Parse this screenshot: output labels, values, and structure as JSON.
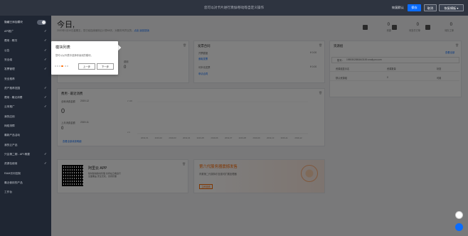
{
  "topbar": {
    "hint": "您可以对卡片进行添加/移动等自定义操作",
    "exit_label": "恢复默认",
    "save_label": "保存",
    "cancel_label": "取消",
    "recover_label": "恢复模板"
  },
  "sidebar": {
    "toggle_label": "隐藏已添加模块",
    "items": [
      {
        "label": "API推广",
        "checked": true
      },
      {
        "label": "费用 - 概况",
        "checked": true
      },
      {
        "label": "公告",
        "checked": true
      },
      {
        "label": "安全组",
        "checked": true
      },
      {
        "label": "发票管理",
        "checked": true
      },
      {
        "label": "安全推荐",
        "checked": false
      },
      {
        "label": "资产推荐范围",
        "checked": true
      },
      {
        "label": "费用 - 最近消费",
        "checked": true
      },
      {
        "label": "云采推广",
        "checked": true
      },
      {
        "label": "我的应用",
        "checked": false
      },
      {
        "label": "网络排障",
        "checked": false
      },
      {
        "label": "最新产品活动",
        "checked": false
      },
      {
        "label": "我的云产品",
        "checked": false
      },
      {
        "label": "只会第二期 - API 概要",
        "checked": true
      },
      {
        "label": "资源包使用",
        "checked": true
      },
      {
        "label": "RAM访问控制",
        "checked": false
      },
      {
        "label": "最近使用的产品",
        "checked": false
      },
      {
        "label": "工作台",
        "checked": false
      }
    ]
  },
  "greeting": {
    "title": "今日,",
    "subtitle": "2020年1月10日星期五，您已经连续使用云计算68天，对服务有异议的，",
    "link1": "点此",
    "link2": "返回旧版"
  },
  "stats": [
    {
      "value": "0",
      "caption": "资源"
    },
    {
      "value": "0",
      "caption": "待支付订单"
    },
    {
      "value": "0",
      "caption": "待办工单"
    }
  ],
  "card_left_top": {
    "title": "",
    "stat_label": "费用",
    "stat_value": "0"
  },
  "card_invoice": {
    "title": "发票合同",
    "rows": [
      {
        "label": "开票额度",
        "value": "¥ 0.00"
      },
      {
        "label": "索取发票",
        "value": ""
      },
      {
        "label": "可申请发票",
        "value": "¥ 0.00"
      },
      {
        "label": "申请合同",
        "value": ""
      }
    ]
  },
  "card_resources": {
    "title": "资源组",
    "account_label": "账号：",
    "account_value": "1989302850843159.onaliyun.com",
    "manage_link": "查看全部",
    "headers": [
      "资源组显示名",
      "资源数量",
      "",
      "状态"
    ],
    "row": [
      "默认资源组",
      "0",
      "",
      "可用"
    ]
  },
  "card_spend": {
    "title": "费用 - 最近消费",
    "month_label": "全局消费金额",
    "month_date": "2019-12",
    "amount": "0",
    "next_label": "上月消费金额",
    "next_date": "2019-11",
    "amount2": "0",
    "link": "查看全部消费明细"
  },
  "chart_data": {
    "type": "bar",
    "categories": [
      "2019-01",
      "2019-02",
      "2019-03",
      "2019-04",
      "2019-05",
      "2019-06",
      "2019-07",
      "2019-08",
      "2019-09",
      "2019-10",
      "2019-11",
      "2019-12"
    ],
    "values": [
      0,
      0,
      0,
      0,
      0,
      0,
      0,
      0,
      0,
      0,
      0,
      0
    ],
    "ylabels": [
      "¥ 100",
      "¥ 0"
    ],
    "xlabel": "",
    "ylabel": ""
  },
  "card_app": {
    "title": "阿里云 APP",
    "desc1": "随时随地移动管理 支持在云端运行",
    "desc2": "全面覆盖 安全无忧，支持管理"
  },
  "card_promo": {
    "title": "第六代服务器震撼发售",
    "subtitle": "内置第二代英特尔至强可扩展处理器",
    "cta": "立即查看"
  },
  "popover": {
    "title": "模块列表",
    "desc": "您可以从列表中选择你喜欢的模块。",
    "prev": "上一步",
    "next": "下一步"
  },
  "colors": {
    "accent": "#0a6cff",
    "sidebar": "#1f2633",
    "promo": "#ff6a00"
  }
}
